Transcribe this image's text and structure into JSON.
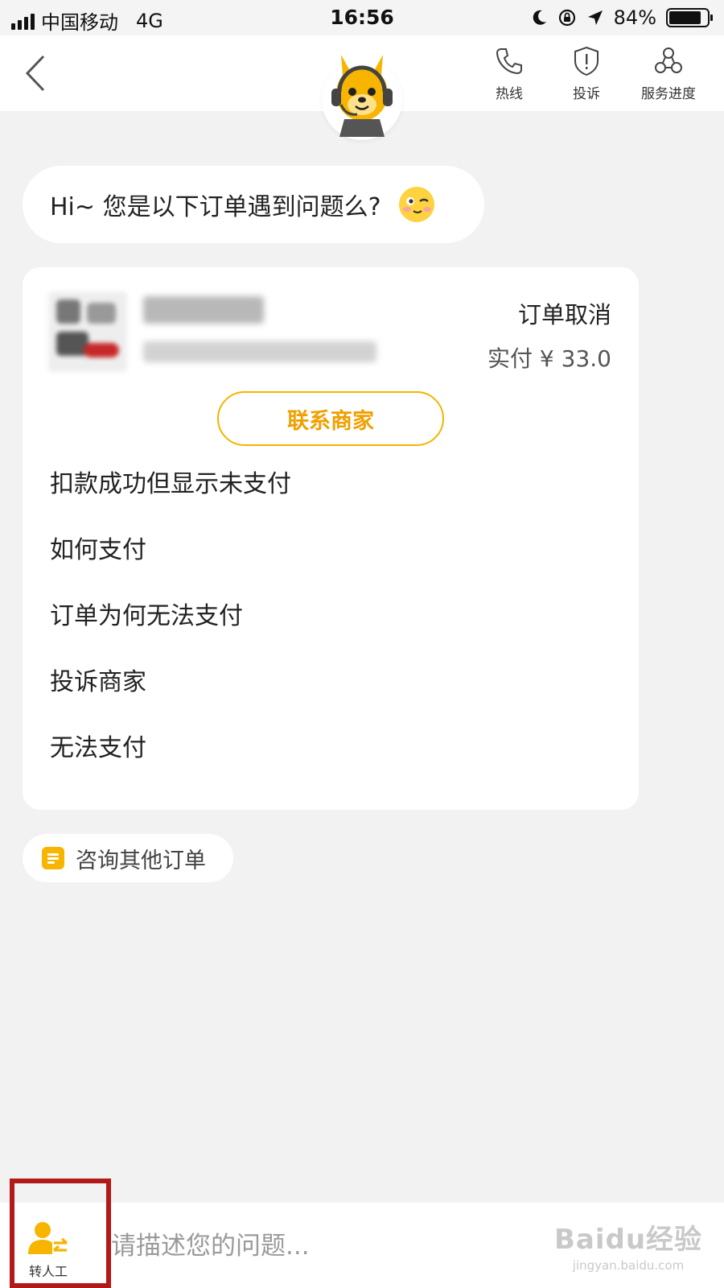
{
  "status_bar": {
    "carrier": "中国移动",
    "network": "4G",
    "time": "16:56",
    "battery": "84%",
    "battery_level": 0.84
  },
  "nav": {
    "actions": [
      {
        "label": "热线",
        "icon": "phone-icon"
      },
      {
        "label": "投诉",
        "icon": "shield-alert-icon"
      },
      {
        "label": "服务进度",
        "icon": "progress-icon"
      }
    ]
  },
  "chat": {
    "greeting": "Hi~ 您是以下订单遇到问题么?"
  },
  "order": {
    "status": "订单取消",
    "paid": "实付 ¥ 33.0",
    "contact_label": "联系商家"
  },
  "faq": [
    "扣款成功但显示未支付",
    "如何支付",
    "订单为何无法支付",
    "投诉商家",
    "无法支付"
  ],
  "other_orders_label": "咨询其他订单",
  "bottom": {
    "handoff_label": "转人工",
    "input_placeholder": "请描述您的问题..."
  },
  "watermark": {
    "brand": "Baidu经验",
    "url": "jingyan.baidu.com"
  },
  "colors": {
    "accent": "#f5b400",
    "highlight": "#b31919",
    "background": "#f2f2f2"
  }
}
